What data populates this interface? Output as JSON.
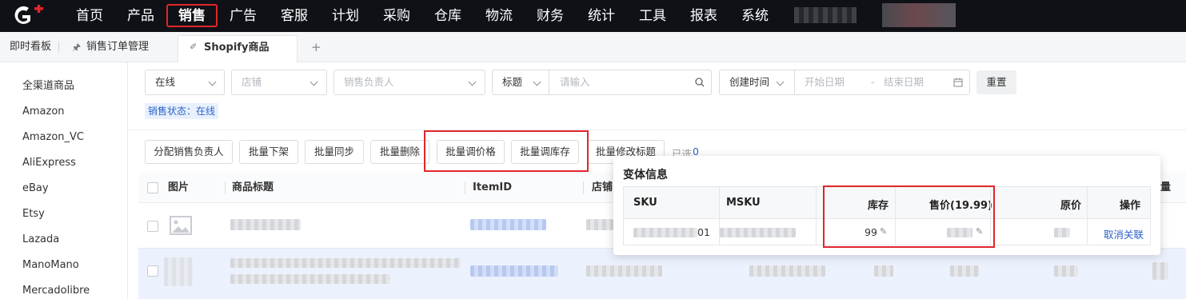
{
  "nav": {
    "items": [
      "首页",
      "产品",
      "销售",
      "广告",
      "客服",
      "计划",
      "采购",
      "仓库",
      "物流",
      "财务",
      "统计",
      "工具",
      "报表",
      "系统"
    ],
    "active": "销售"
  },
  "tabs": {
    "home": "即时看板",
    "orders": "销售订单管理",
    "active": "Shopify商品",
    "add": "+"
  },
  "sidebar": {
    "items": [
      "全渠道商品",
      "Amazon",
      "Amazon_VC",
      "AliExpress",
      "eBay",
      "Etsy",
      "Lazada",
      "ManoMano",
      "Mercadolibre"
    ]
  },
  "filters": {
    "status_value": "在线",
    "store_placeholder": "店铺",
    "owner_placeholder": "销售负责人",
    "field_value": "标题",
    "search_placeholder": "请输入",
    "date_type": "创建时间",
    "start_placeholder": "开始日期",
    "range_sep": "-",
    "end_placeholder": "结束日期",
    "reset": "重置",
    "status_tag": "销售状态：在线"
  },
  "actions": {
    "assign_owner": "分配销售负责人",
    "bulk_delist": "批量下架",
    "bulk_sync": "批量同步",
    "bulk_delete": "批量删除",
    "bulk_price": "批量调价格",
    "bulk_stock": "批量调库存",
    "bulk_title": "批量修改标题",
    "selected_label": "已选",
    "selected_count": "0"
  },
  "table": {
    "headers": {
      "image": "图片",
      "title": "商品标题",
      "item_id": "ItemID",
      "store": "店铺",
      "last": "量"
    }
  },
  "popover": {
    "title": "变体信息",
    "headers": {
      "sku": "SKU",
      "msku": "MSKU",
      "stock": "库存",
      "price": "售价(19.99)",
      "orig_price": "原价",
      "action": "操作"
    },
    "row": {
      "sku_suffix": "01",
      "stock": "99",
      "action": "取消关联"
    }
  },
  "colors": {
    "nav_bg": "#0f1117",
    "highlight_red": "#e0262b",
    "link_blue": "#2b63c8",
    "selected_row": "#ecf2fd"
  }
}
